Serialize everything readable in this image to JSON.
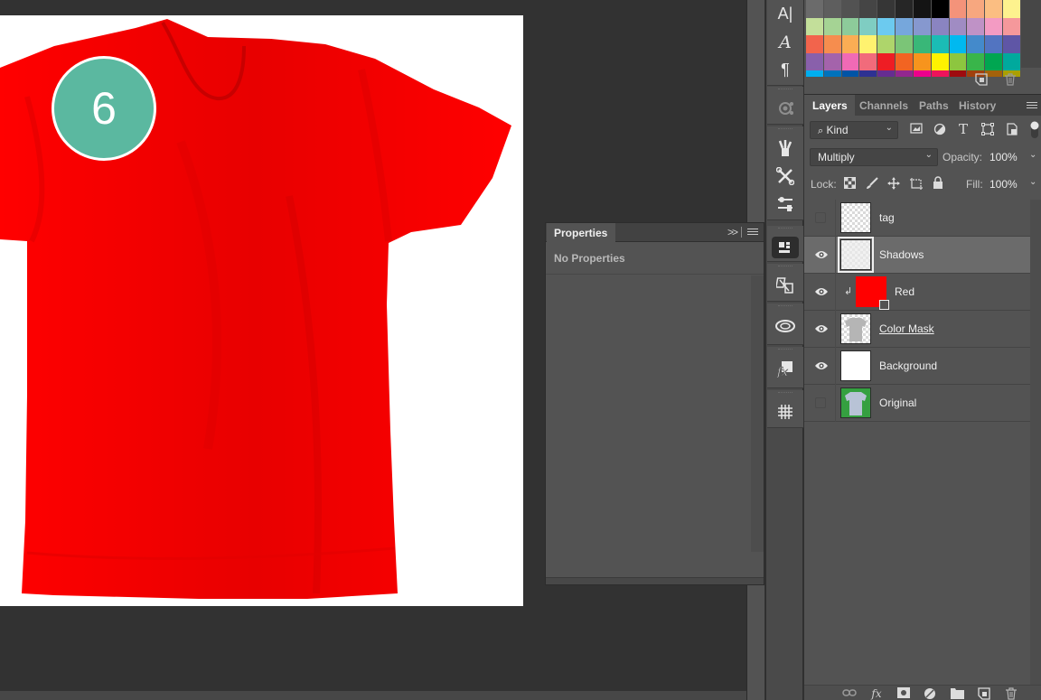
{
  "canvas": {
    "badge_number": "6",
    "shirt_color": "#ff0000",
    "badge_color": "#5bb8a0"
  },
  "properties_panel": {
    "tab_label": "Properties",
    "collapse_label": ">>",
    "empty_message": "No Properties"
  },
  "icon_strip": {
    "groups": [
      [
        "character-icon",
        "character-styles-icon",
        "paragraph-icon"
      ],
      [
        "3d-material-icon"
      ],
      [
        "brushes-icon",
        "tool-presets-icon",
        "adjustments-icon"
      ],
      [
        "device-preview-icon"
      ],
      [
        "clone-source-icon"
      ],
      [
        "libraries-icon"
      ],
      [
        "styles-icon"
      ],
      [
        "glyphs-icon"
      ]
    ]
  },
  "swatches": {
    "rows": [
      [
        "#6b6b6b",
        "#5e5e5e",
        "#525252",
        "#454545",
        "#363636",
        "#262626",
        "#141414",
        "#000000",
        "#f4937a",
        "#f7a77f",
        "#fbbe82",
        "#fdf28e"
      ],
      [
        "#c3df9a",
        "#a5d394",
        "#8dcb9a",
        "#7fcdc2",
        "#6ccaef",
        "#76a7dc",
        "#8698cf",
        "#8a84c1",
        "#a08cc3",
        "#bf92c6",
        "#f39bc3",
        "#f5989b"
      ],
      [
        "#f2644c",
        "#f68d4e",
        "#fbad54",
        "#fff26f",
        "#aed56b",
        "#7bc577",
        "#39b778",
        "#1bbcb5",
        "#00b9f0",
        "#448acb",
        "#5274c1",
        "#5f56a6"
      ],
      [
        "#8960ab",
        "#a463ab",
        "#f06ab5",
        "#f16b7b",
        "#ee1d24",
        "#f26422",
        "#f7941d",
        "#fff200",
        "#8dc63f",
        "#39b54a",
        "#00a651",
        "#00a99d"
      ],
      [
        "#00aeef",
        "#0072bc",
        "#0054a6",
        "#2e3192",
        "#662d91",
        "#92278f",
        "#ec008c",
        "#ed145b",
        "#9e0b0f",
        "#a0410d",
        "#a3620a",
        "#aba000"
      ]
    ]
  },
  "layers_panel": {
    "tabs": [
      {
        "label": "Layers",
        "active": true
      },
      {
        "label": "Channels",
        "active": false
      },
      {
        "label": "Paths",
        "active": false
      },
      {
        "label": "History",
        "active": false
      }
    ],
    "filter_kind": "Kind",
    "blend_mode": "Multiply",
    "opacity_label": "Opacity:",
    "opacity_value": "100%",
    "lock_label": "Lock:",
    "fill_label": "Fill:",
    "fill_value": "100%",
    "layers": [
      {
        "name": "tag",
        "visible": false,
        "selected": false,
        "thumb": "transparent",
        "clipped": false
      },
      {
        "name": "Shadows",
        "visible": true,
        "selected": true,
        "thumb": "shadows",
        "clipped": false
      },
      {
        "name": "Red",
        "visible": true,
        "selected": false,
        "thumb": "#ff0000",
        "clipped": true
      },
      {
        "name": "Color Mask",
        "visible": true,
        "selected": false,
        "thumb": "mask",
        "clipped": false
      },
      {
        "name": "Background",
        "visible": true,
        "selected": false,
        "thumb": "#ffffff",
        "clipped": false
      },
      {
        "name": "Original",
        "visible": false,
        "selected": false,
        "thumb": "original",
        "clipped": false
      }
    ],
    "footer_buttons": [
      "link-layers",
      "fx",
      "add-mask",
      "adjustment-layer",
      "new-group",
      "new-layer",
      "delete-layer"
    ]
  }
}
